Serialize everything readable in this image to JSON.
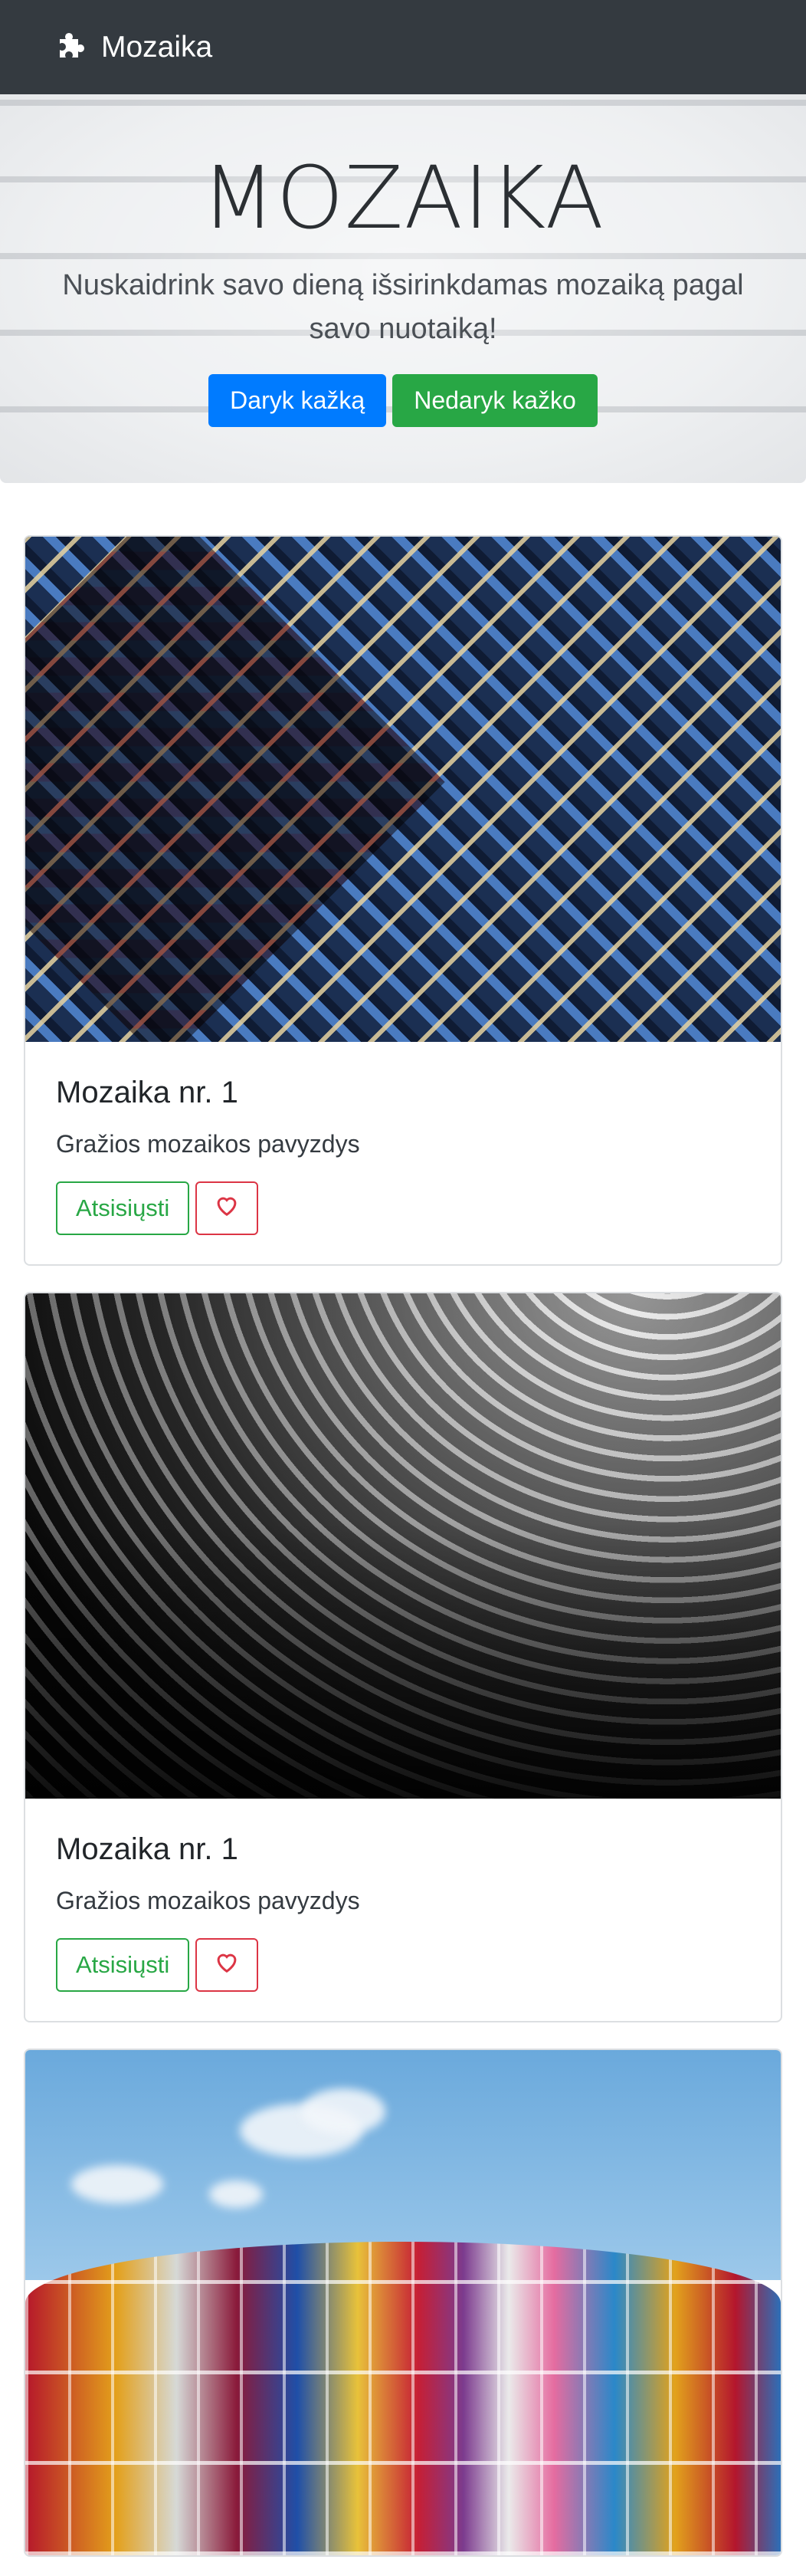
{
  "navbar": {
    "brand": "Mozaika",
    "brand_icon": "puzzle-piece-icon"
  },
  "hero": {
    "title": "MOZAIKA",
    "lead": "Nuskaidrink savo dieną išsirinkdamas mozaiką pagal savo nuotaiką!",
    "primary_button": "Daryk kažką",
    "secondary_button": "Nedaryk kažko"
  },
  "cards": [
    {
      "title": "Mozaika nr. 1",
      "text": "Gražios mozaikos pavyzdys",
      "download_label": "Atsisiųsti",
      "like_icon": "heart-icon"
    },
    {
      "title": "Mozaika nr. 1",
      "text": "Gražios mozaikos pavyzdys",
      "download_label": "Atsisiųsti",
      "like_icon": "heart-icon"
    }
  ],
  "colors": {
    "navbar": "#343a40",
    "primary": "#007bff",
    "success": "#28a745",
    "danger": "#dc3545"
  }
}
